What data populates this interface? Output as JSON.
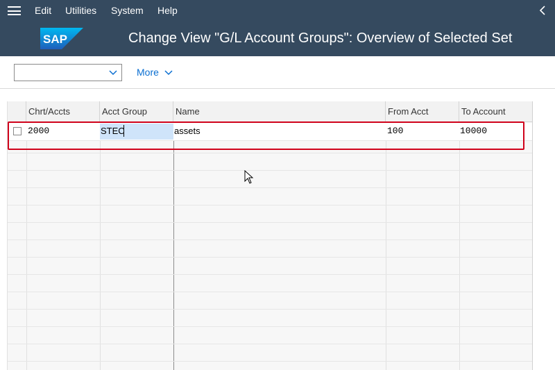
{
  "menu": {
    "items": [
      {
        "label": "Edit"
      },
      {
        "label": "Utilities"
      },
      {
        "label": "System"
      },
      {
        "label": "Help"
      }
    ]
  },
  "header": {
    "logo_text": "SAP",
    "title": "Change View \"G/L Account Groups\": Overview of Selected Set"
  },
  "toolbar": {
    "dropdown_value": "",
    "more_label": "More"
  },
  "table": {
    "columns": [
      "Chrt/Accts",
      "Acct Group",
      "Name",
      "From Acct",
      "To Account"
    ],
    "rows": [
      {
        "chart": "2000",
        "group": "STEC",
        "name": "assets",
        "from": "100",
        "to": "10000"
      }
    ]
  },
  "colors": {
    "shell": "#354a5f",
    "accent": "#0a6ed1",
    "highlight": "#d0021b",
    "selection": "#cfe4fa"
  }
}
